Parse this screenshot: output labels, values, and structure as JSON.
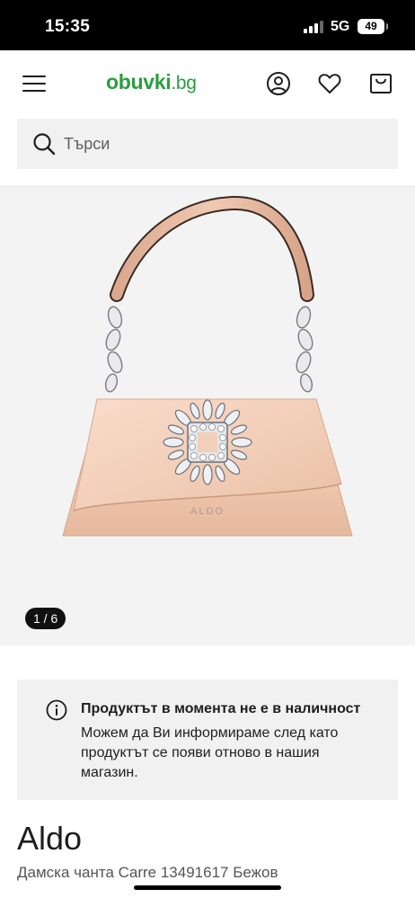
{
  "status_bar": {
    "time": "15:35",
    "network": "5G",
    "battery": "49"
  },
  "header": {
    "logo_main": "obuvki",
    "logo_tld": ".bg",
    "menu_icon": "hamburger-menu-icon",
    "account_icon": "user-icon",
    "wishlist_icon": "heart-icon",
    "cart_icon": "shopping-bag-icon"
  },
  "search": {
    "placeholder": "Търси",
    "icon": "search-icon"
  },
  "gallery": {
    "counter": "1 / 6",
    "image_text": "ALDO"
  },
  "notice": {
    "icon": "info-icon",
    "title": "Продуктът в момента не е в наличност",
    "line1": "Можем да Ви информираме след като",
    "line2": "продуктът се появи отново в нашия",
    "line3": "магазин."
  },
  "product": {
    "brand": "Aldo",
    "name": "Дамска чанта Carre 13491617 Бежов"
  },
  "colors": {
    "brand_green": "#2a9d3e",
    "panel_bg": "#f1f1f1",
    "gallery_bg": "#f3f3f3",
    "bag_color": "#f2cdb7"
  }
}
